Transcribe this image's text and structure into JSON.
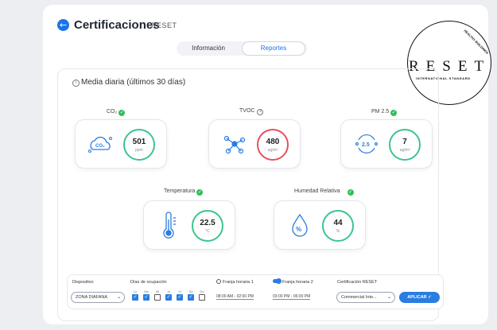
{
  "header": {
    "title": "Certificaciones",
    "subtitle": "RESET",
    "back_icon": "arrow-left-icon"
  },
  "tabs": [
    {
      "label": "Información",
      "active": false
    },
    {
      "label": "Reportes",
      "active": true
    }
  ],
  "logo": {
    "text": "RESET",
    "subtitle": "INTERNATIONAL STANDARD",
    "arc_text": "HEALTHY BUILDINGS"
  },
  "panel": {
    "title": "Media diaria (últimos 30 días)"
  },
  "metrics": [
    {
      "label": "CO₂",
      "value": "501",
      "unit": "ppm",
      "status": "ok",
      "icon": "co2-cloud-icon",
      "ring_color": "#3cc48d"
    },
    {
      "label": "TVOC",
      "value": "480",
      "unit": "ug/m³",
      "status": "add",
      "icon": "molecule-icon",
      "ring_color": "#e8505b"
    },
    {
      "label": "PM 2.5",
      "value": "7",
      "unit": "ug/m³",
      "status": "ok",
      "icon": "pm25-particles-icon",
      "ring_color": "#3cc48d"
    },
    {
      "label": "Temperatura",
      "value": "22.5",
      "unit": "°C",
      "status": "ok",
      "icon": "thermometer-icon",
      "ring_color": "#3cc48d"
    },
    {
      "label": "Humedad Relativa",
      "value": "44",
      "unit": "%",
      "status": "ok",
      "icon": "humidity-drop-icon",
      "ring_color": "#3cc48d"
    }
  ],
  "filters": {
    "device_label": "Dispositivo",
    "device_value": "ZONA DIAFANA",
    "days_label": "Días de ocupación",
    "days": [
      {
        "label": "Lu",
        "checked": true
      },
      {
        "label": "Ma",
        "checked": true
      },
      {
        "label": "Mi",
        "checked": false
      },
      {
        "label": "Ju",
        "checked": true
      },
      {
        "label": "Vi",
        "checked": true
      },
      {
        "label": "Sa",
        "checked": true
      },
      {
        "label": "Do",
        "checked": false
      }
    ],
    "range1_label": "Franja horaria 1",
    "range1_value": "08:00 AM - 02:00 PM",
    "range2_label": "Franja horaria 2",
    "range2_value": "03:00 PM - 06:00 PM",
    "cert_label": "Certificación RESET",
    "cert_value": "Commercial Inte...",
    "apply_label": "APLICAR ✓"
  },
  "colors": {
    "accent": "#2a7de1",
    "ok": "#2fbf5b",
    "alert": "#e8505b"
  }
}
